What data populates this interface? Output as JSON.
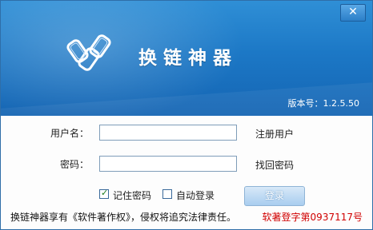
{
  "window": {
    "close_glyph": "✕"
  },
  "header": {
    "logo_icon": "chain-link-logo",
    "title": "换链神器",
    "version": "版本号：1.2.5.50",
    "banner_color": "#1c78c6"
  },
  "form": {
    "username_label": "用户名：",
    "username_value": "",
    "password_label": "密码：",
    "password_value": "",
    "register_link": "注册用户",
    "recover_link": "找回密码"
  },
  "options": {
    "remember_label": "记住密码",
    "remember_checked": true,
    "autologin_label": "自动登录",
    "autologin_checked": false,
    "check_glyph": "✓"
  },
  "actions": {
    "login_label": "登录"
  },
  "footer": {
    "copyright": "换链神器享有《软件著作权》，侵权将追究法律责任。",
    "registration": "软著登字第0937117号",
    "registration_color": "#d00000"
  }
}
